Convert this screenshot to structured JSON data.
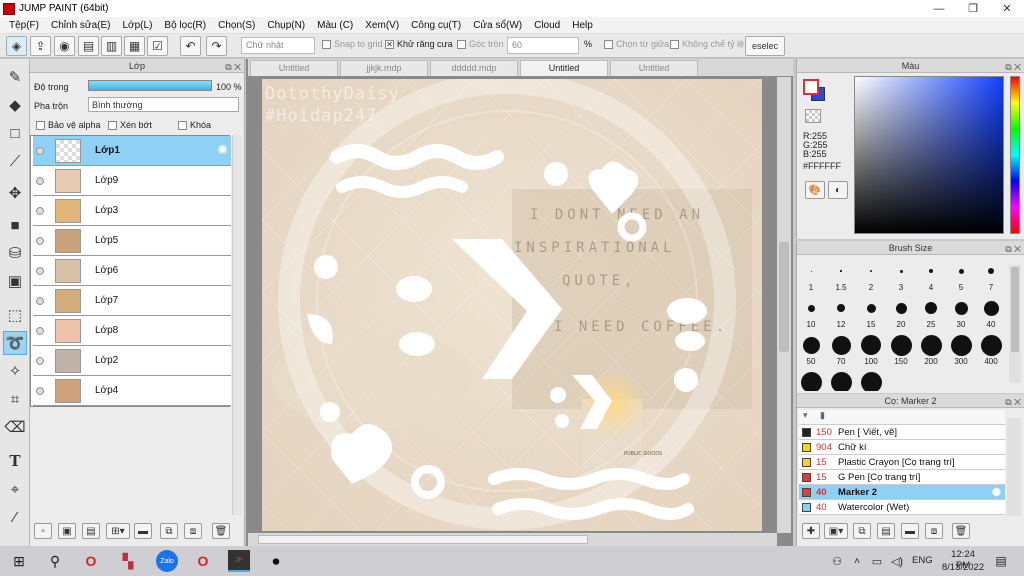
{
  "window": {
    "title": "JUMP PAINT (64bit)"
  },
  "menu": [
    "Tệp(F)",
    "Chỉnh sửa(E)",
    "Lớp(L)",
    "Bộ lọc(R)",
    "Chọn(S)",
    "Chụp(N)",
    "Màu (C)",
    "Xem(V)",
    "Công cụ(T)",
    "Cửa sổ(W)",
    "Cloud",
    "Help"
  ],
  "toolbar": {
    "shape_select": "Chữ nhật",
    "snap_to_grid": "Snap to grid",
    "antialias": "Khử răng cưa",
    "round_corner": "Góc tròn",
    "round_value": "60",
    "percent": "%",
    "select_center": "Chọn từ giữa",
    "fixed_ratio": "Không chế tỷ lệ",
    "deselect": "eselec"
  },
  "layer_panel": {
    "title": "Lớp",
    "opacity_label": "Độ trong",
    "opacity_value": "100 %",
    "opacity_percent": 100,
    "blend_label": "Pha trộn",
    "blend_value": "Bình thường",
    "protect_alpha": "Bảo vệ alpha",
    "clipping": "Xén bớt",
    "lock": "Khóa",
    "layers": [
      {
        "name": "Lớp1",
        "selected": true
      },
      {
        "name": "Lớp9"
      },
      {
        "name": "Lớp3"
      },
      {
        "name": "Lớp5"
      },
      {
        "name": "Lớp6"
      },
      {
        "name": "Lớp7"
      },
      {
        "name": "Lớp8"
      },
      {
        "name": "Lớp2"
      },
      {
        "name": "Lớp4"
      }
    ]
  },
  "doc_tabs": [
    "Untitled",
    "jjkjk.mdp",
    "ddddd.mdp",
    "Untitled",
    "Untitled"
  ],
  "active_doc_tab": 3,
  "canvas": {
    "watermark_line1": "DotothyDaisy",
    "watermark_line2": "#Hoidap247",
    "photo_text": [
      "I DONT NEED AN",
      "INSPIRATIONAL",
      "QUOTE,",
      "I NEED COFFEE."
    ],
    "candle_label": "PUBLIC GOODS"
  },
  "color_panel": {
    "title": "Màu",
    "r": "R:255",
    "g": "G:255",
    "b": "B:255",
    "hex": "#FFFFFF"
  },
  "brush_size_panel": {
    "title": "Brush Size",
    "sizes": [
      "1",
      "1.5",
      "2",
      "3",
      "4",
      "5",
      "7",
      "10",
      "12",
      "15",
      "20",
      "25",
      "30",
      "40",
      "50",
      "70",
      "100",
      "150",
      "200",
      "300",
      "400"
    ]
  },
  "brush_panel": {
    "title": "Cọ: Marker 2",
    "items": [
      {
        "size": "150",
        "name": "Pen [ Viết, vẽ]",
        "color": "#222222"
      },
      {
        "size": "904",
        "name": "Chữ kí",
        "color": "#f2d21b"
      },
      {
        "size": "15",
        "name": "Plastic Crayon [Cọ trang trí]",
        "color": "#f2d21b"
      },
      {
        "size": "15",
        "name": "G Pen [Cọ trang trí]",
        "color": "#e53a3a"
      },
      {
        "size": "40",
        "name": "Marker 2",
        "color": "#e53a3a",
        "selected": true
      },
      {
        "size": "40",
        "name": "Watercolor (Wet)",
        "color": "#7fd6f0"
      }
    ]
  },
  "taskbar": {
    "language": "ENG",
    "time": "12:24 PM",
    "date": "8/13/2022"
  }
}
